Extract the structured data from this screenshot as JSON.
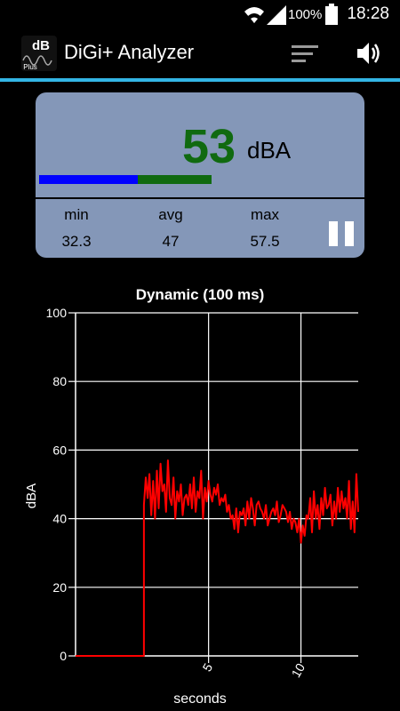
{
  "status_bar": {
    "battery_percent": "100%",
    "time": "18:28",
    "icons": [
      "wifi-icon",
      "signal-icon",
      "battery-icon"
    ]
  },
  "action_bar": {
    "title": "DiGi+ Analyzer",
    "logo_text": "dB",
    "logo_subtext": "Plus",
    "accent_color": "#33b5e5"
  },
  "level": {
    "value": "53",
    "unit": "dBA",
    "bar_avg_fraction": 0.57,
    "bar_total_fraction": 1.0,
    "stats": [
      {
        "label": "min",
        "value": "32.3"
      },
      {
        "label": "avg",
        "value": "47"
      },
      {
        "label": "max",
        "value": "57.5"
      }
    ]
  },
  "chart_data": {
    "type": "line",
    "title": "Dynamic (100 ms)",
    "xlabel": "seconds",
    "ylabel": "dBA",
    "xlim": [
      -2.2,
      13.1
    ],
    "ylim": [
      0,
      100
    ],
    "yticks": [
      0,
      20,
      40,
      60,
      80,
      100
    ],
    "xticks": [
      5,
      10
    ],
    "grid": true,
    "series": [
      {
        "color": "#ff0000",
        "x": [
          -2.2,
          1.5,
          1.5,
          1.6,
          1.7,
          1.8,
          1.9,
          2.0,
          2.1,
          2.2,
          2.3,
          2.4,
          2.5,
          2.6,
          2.7,
          2.8,
          2.9,
          3.0,
          3.1,
          3.2,
          3.3,
          3.4,
          3.5,
          3.6,
          3.7,
          3.8,
          3.9,
          4.0,
          4.1,
          4.2,
          4.3,
          4.4,
          4.5,
          4.6,
          4.7,
          4.8,
          4.9,
          5.0,
          5.1,
          5.2,
          5.3,
          5.4,
          5.5,
          5.6,
          5.7,
          5.8,
          5.9,
          6.0,
          6.1,
          6.2,
          6.3,
          6.4,
          6.5,
          6.6,
          6.7,
          6.8,
          6.9,
          7.0,
          7.1,
          7.2,
          7.3,
          7.4,
          7.5,
          7.6,
          7.7,
          7.8,
          7.9,
          8.0,
          8.1,
          8.2,
          8.3,
          8.4,
          8.5,
          8.6,
          8.7,
          8.8,
          8.9,
          9.0,
          9.1,
          9.2,
          9.3,
          9.4,
          9.5,
          9.6,
          9.7,
          9.8,
          9.9,
          10.0,
          10.1,
          10.2,
          10.3,
          10.4,
          10.5,
          10.6,
          10.7,
          10.8,
          10.9,
          11.0,
          11.1,
          11.2,
          11.3,
          11.4,
          11.5,
          11.6,
          11.7,
          11.8,
          11.9,
          12.0,
          12.1,
          12.2,
          12.3,
          12.4,
          12.5,
          12.6,
          12.7,
          12.8,
          12.9,
          13.0,
          13.1
        ],
        "values": [
          0,
          0,
          44,
          52,
          46,
          53,
          41,
          51,
          40,
          54,
          43,
          56,
          48,
          50,
          42,
          57,
          46,
          44,
          52,
          40,
          48,
          45,
          50,
          41,
          46,
          47,
          44,
          50,
          43,
          52,
          42,
          48,
          46,
          54,
          40,
          49,
          45,
          51,
          47,
          45,
          49,
          47,
          50,
          44,
          46,
          45,
          47,
          42,
          44,
          40,
          41,
          37,
          43,
          36,
          42,
          41,
          43,
          38,
          45,
          40,
          46,
          43,
          38,
          44,
          45,
          43,
          42,
          40,
          44,
          38,
          40,
          42,
          43,
          41,
          45,
          39,
          41,
          44,
          43,
          42,
          39,
          42,
          37,
          40,
          39,
          36,
          40,
          33,
          38,
          35,
          41,
          40,
          46,
          36,
          48,
          40,
          44,
          37,
          46,
          41,
          49,
          43,
          44,
          47,
          38,
          45,
          40,
          49,
          42,
          48,
          43,
          46,
          40,
          51,
          37,
          45,
          36,
          53,
          42
        ]
      }
    ]
  }
}
